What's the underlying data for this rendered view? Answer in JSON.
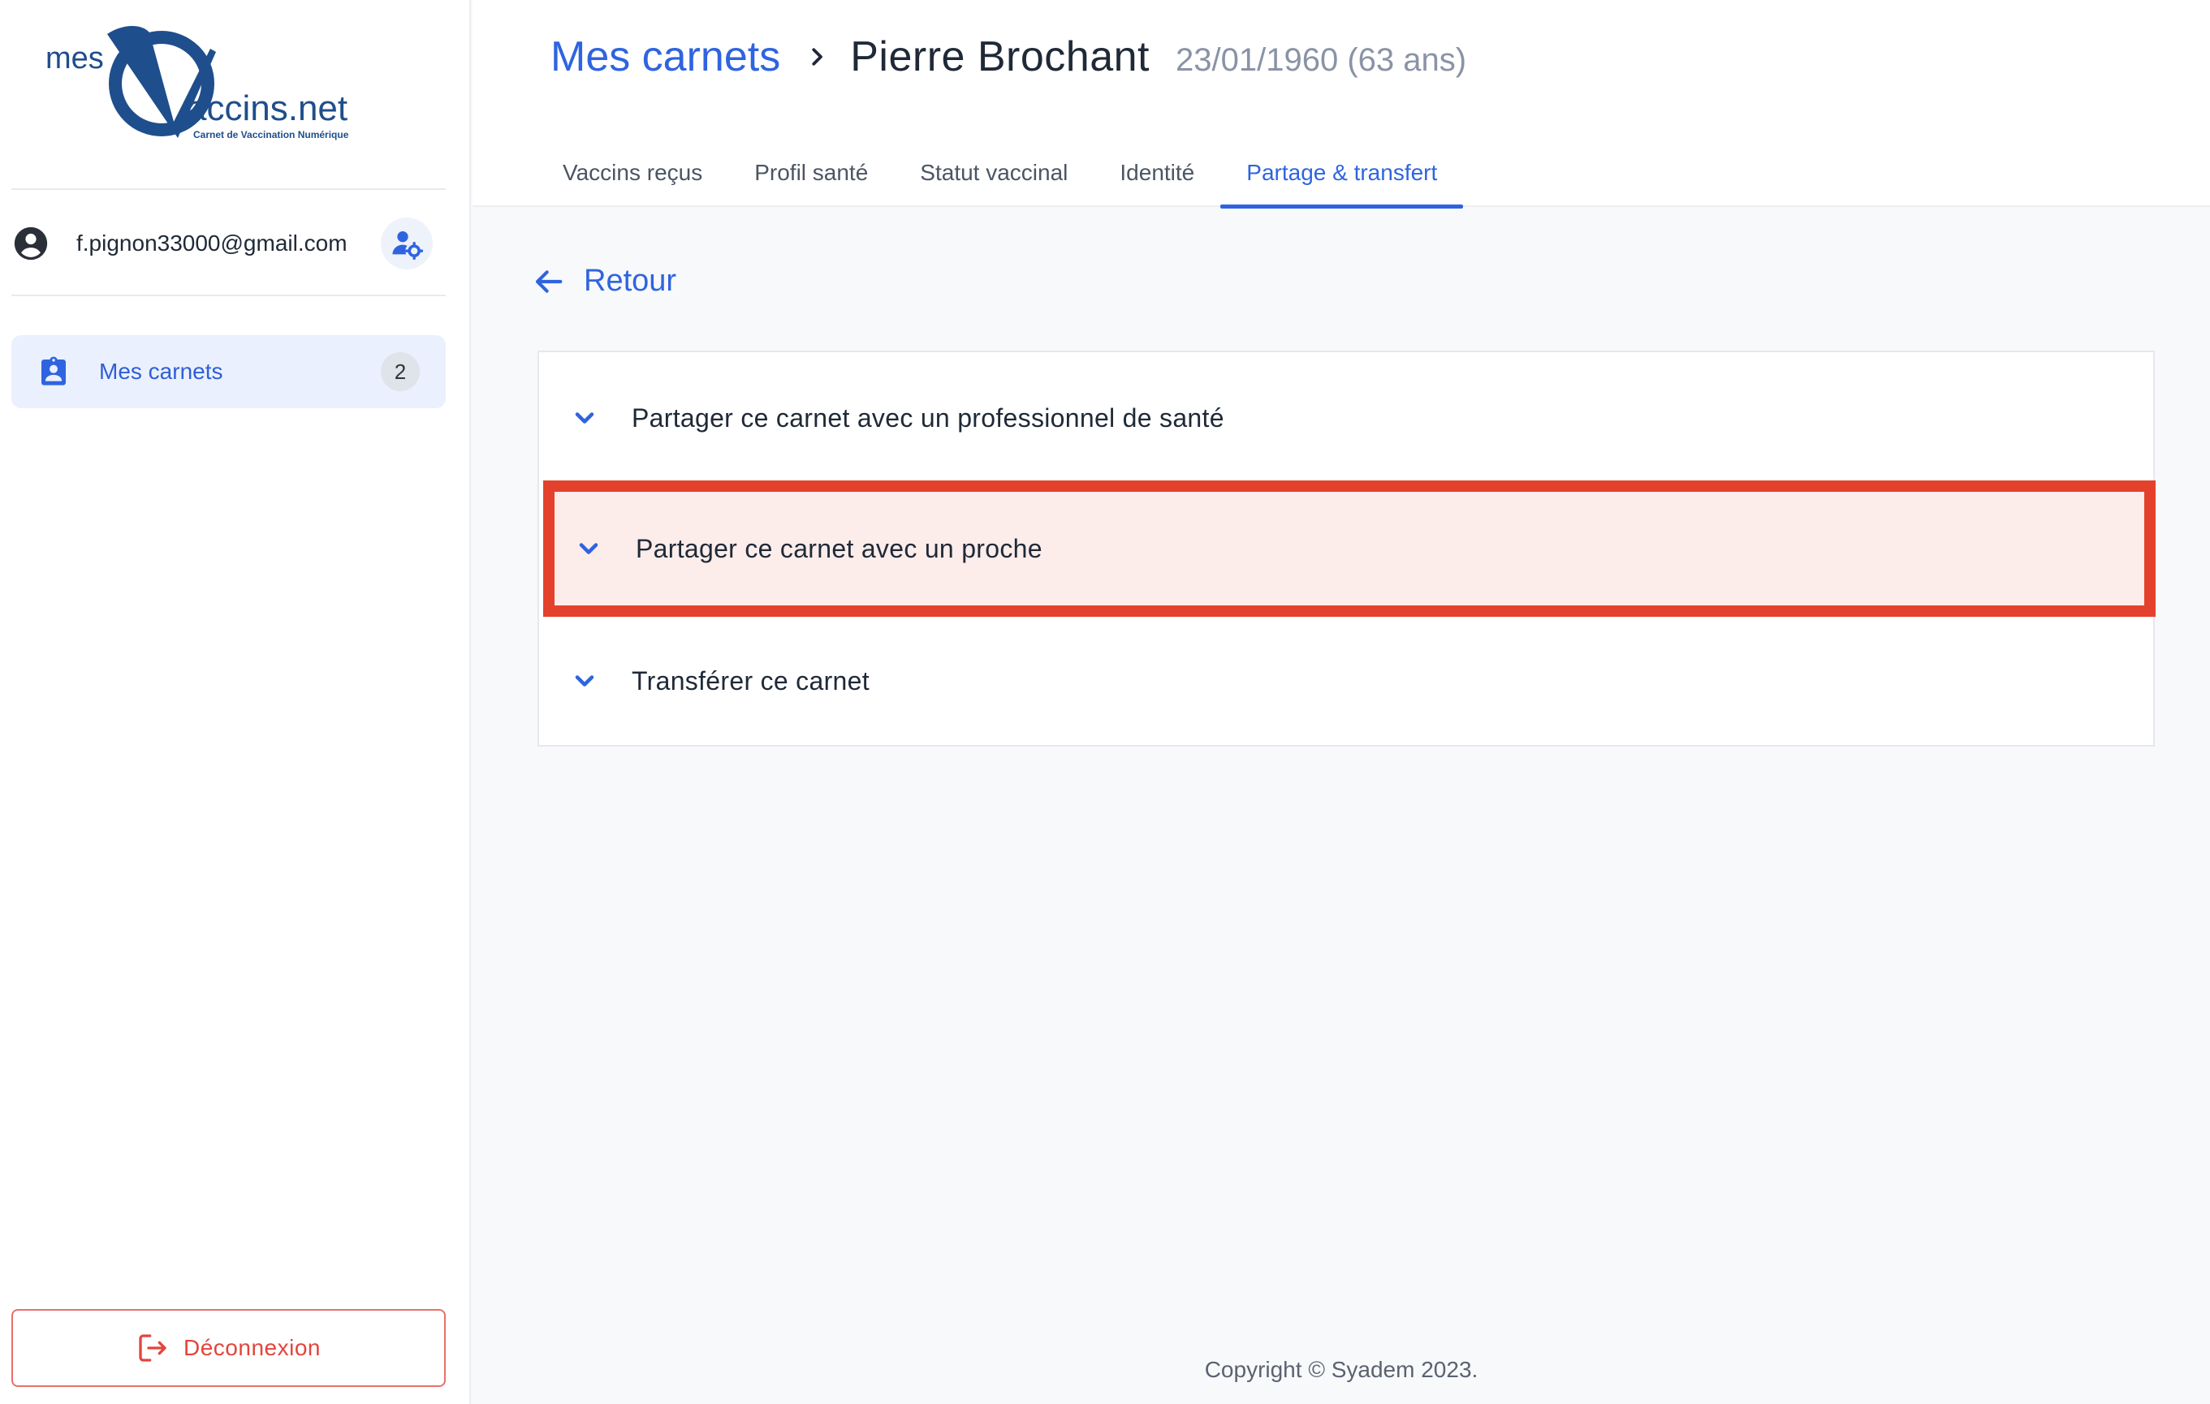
{
  "sidebar": {
    "logo": {
      "prefix": "mes",
      "main": "accins.net",
      "tagline": "Carnet de Vaccination Numérique"
    },
    "user": {
      "email": "f.pignon33000@gmail.com"
    },
    "nav": [
      {
        "label": "Mes carnets",
        "count": "2",
        "icon": "clipboard-account-icon"
      }
    ],
    "logout_label": "Déconnexion"
  },
  "header": {
    "breadcrumb_root": "Mes carnets",
    "patient_name": "Pierre Brochant",
    "patient_dob": "23/01/1960 (63 ans)",
    "tabs": [
      {
        "label": "Vaccins reçus",
        "active": false
      },
      {
        "label": "Profil santé",
        "active": false
      },
      {
        "label": "Statut vaccinal",
        "active": false
      },
      {
        "label": "Identité",
        "active": false
      },
      {
        "label": "Partage & transfert",
        "active": true
      }
    ]
  },
  "main": {
    "back_label": "Retour",
    "accordion": [
      {
        "label": "Partager ce carnet avec un professionnel de santé",
        "highlighted": false
      },
      {
        "label": "Partager ce carnet avec un proche",
        "highlighted": true
      },
      {
        "label": "Transférer ce carnet",
        "highlighted": false
      }
    ]
  },
  "footer": {
    "copyright": "Copyright © Syadem 2023."
  },
  "colors": {
    "accent": "#2f64e0",
    "danger": "#e2453c",
    "highlight_border": "#e4412c",
    "highlight_bg": "#fcecea"
  }
}
